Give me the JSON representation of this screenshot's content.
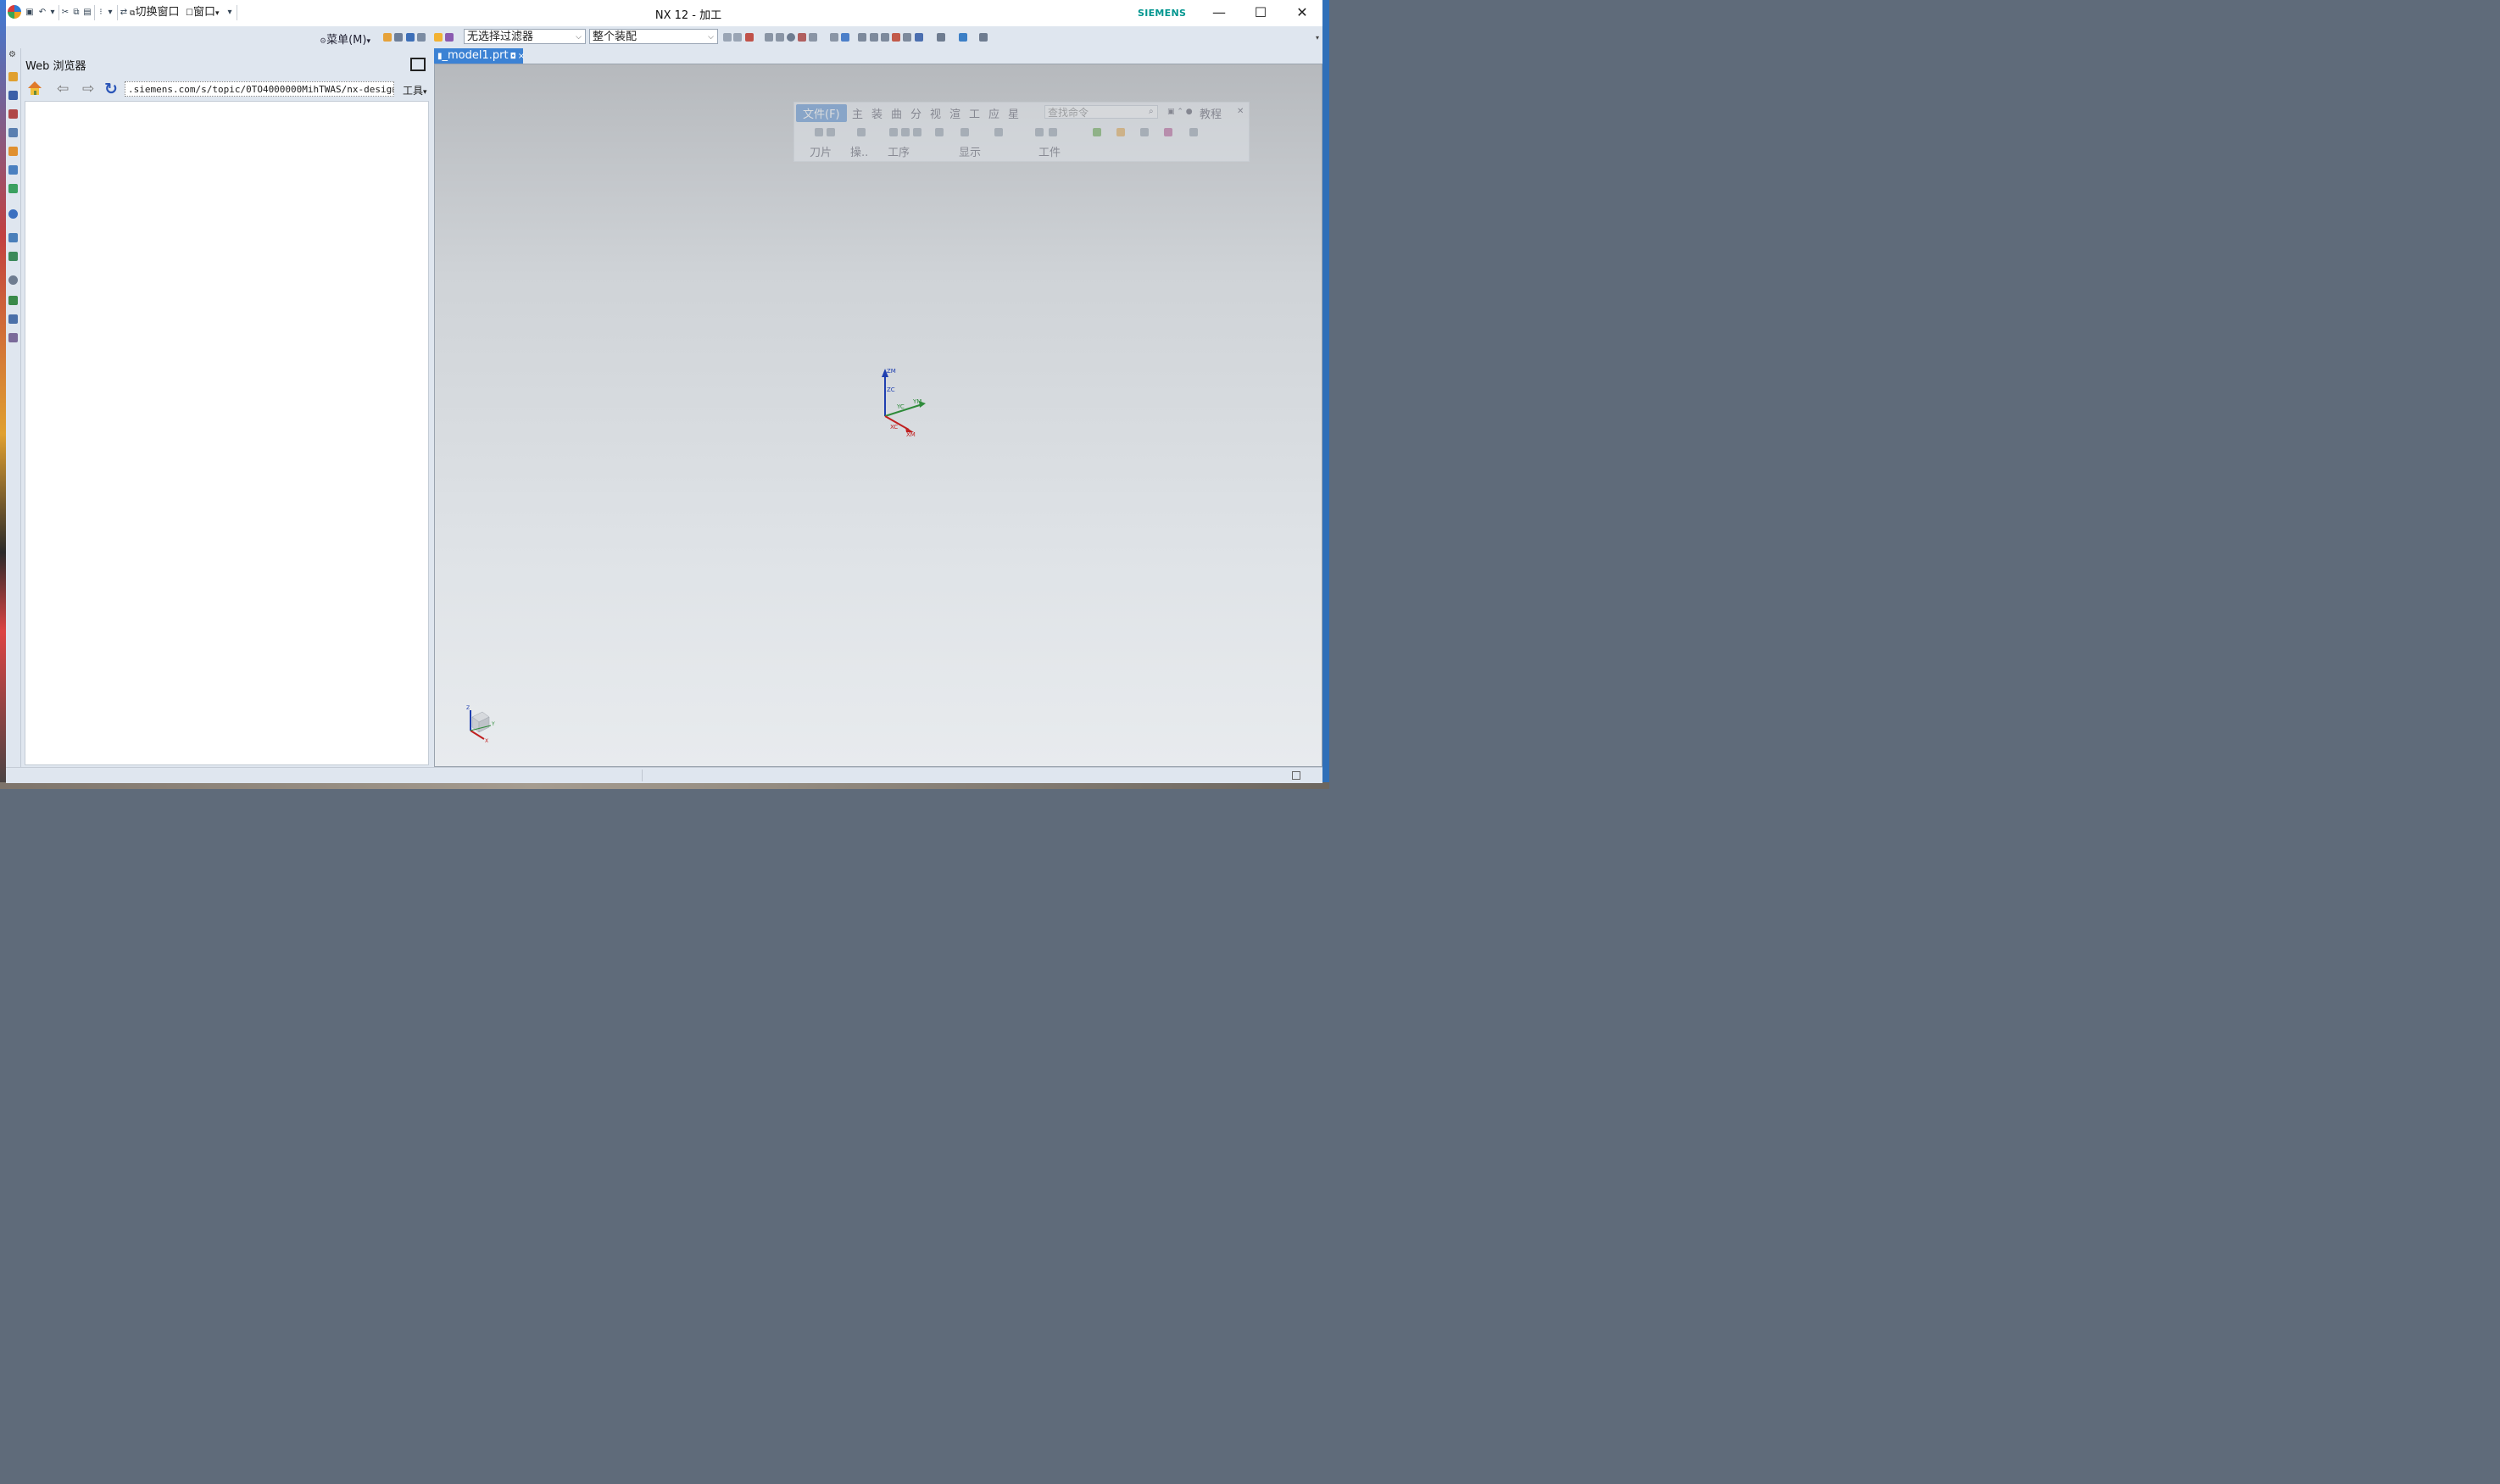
{
  "window": {
    "title": "NX 12 - 加工",
    "brand": "SIEMENS",
    "controls": {
      "minimize": "—",
      "maximize": "☐",
      "close": "✕"
    }
  },
  "quick_access": {
    "switch_window": "切换窗口",
    "window_menu": "窗口"
  },
  "toolbar": {
    "menu_label": "菜单(M)",
    "filter_value": "无选择过滤器",
    "scope_value": "整个装配"
  },
  "web_browser": {
    "title": "Web 浏览器",
    "url": ".siemens.com/s/topic/0TO4000000MihTWAS/nx-design",
    "tools_label": "工具"
  },
  "graphics": {
    "tab_label": "_model1.prt",
    "wcs_labels": {
      "zm": "ZM",
      "zc": "ZC",
      "yc": "YC",
      "ym": "YM",
      "xc": "XC",
      "xm": "XM"
    },
    "abs_labels": {
      "z": "Z",
      "x": "X",
      "y": "Y"
    }
  },
  "ribbon": {
    "tabs": [
      "文件(F)",
      "主",
      "装",
      "曲",
      "分",
      "视",
      "渲",
      "工",
      "应",
      "星"
    ],
    "search_placeholder": "查找命令",
    "tutorial": "教程",
    "groups": [
      "刀片",
      "操..",
      "工序",
      "显示",
      "工件"
    ]
  },
  "colors": {
    "accent": "#3c82d4",
    "brand": "#00968f",
    "panel_bg": "#dfe6ef"
  }
}
